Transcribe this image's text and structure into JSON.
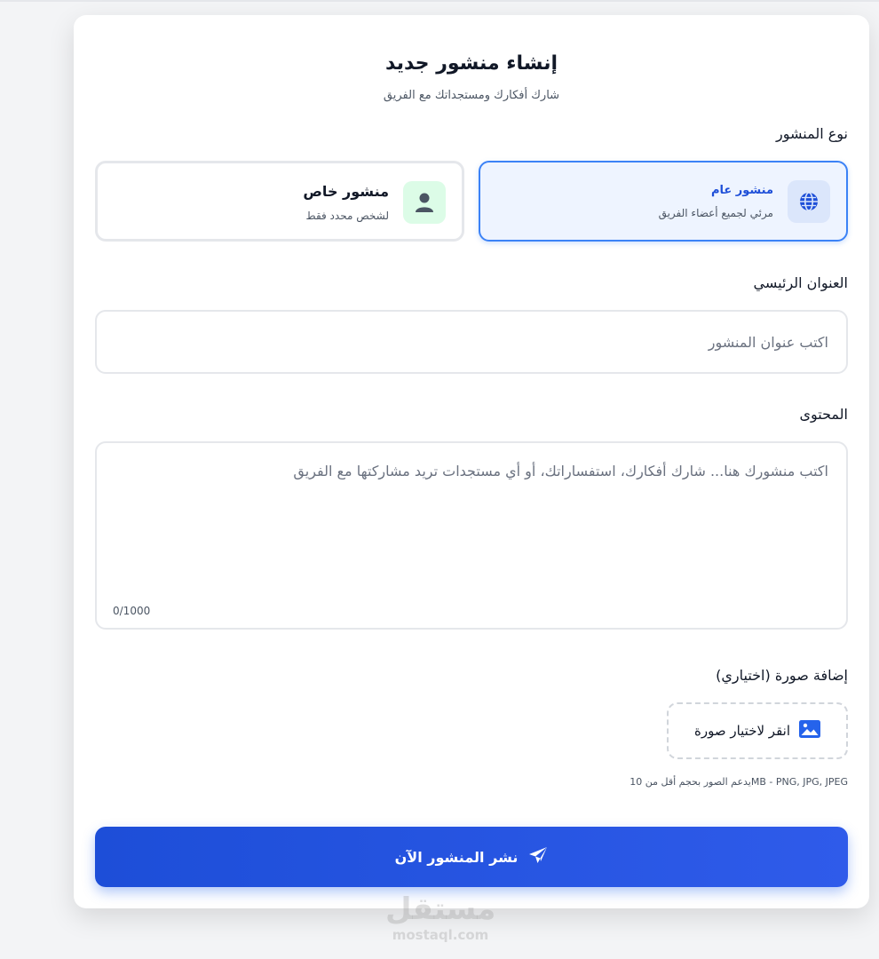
{
  "header": {
    "title": "إنشاء منشور جديد",
    "subtitle": "شارك أفكارك ومستجداتك مع الفريق"
  },
  "post_type": {
    "label": "نوع المنشور",
    "public": {
      "title": "منشور عام",
      "description": "مرئي لجميع أعضاء الفريق",
      "icon": "globe-icon",
      "selected": true
    },
    "private": {
      "title": "منشور خاص",
      "description": "لشخص محدد فقط",
      "icon": "user-icon",
      "selected": false
    }
  },
  "main_title": {
    "label": "العنوان الرئيسي",
    "placeholder": "اكتب عنوان المنشور",
    "value": ""
  },
  "content": {
    "label": "المحتوى",
    "placeholder": "اكتب منشورك هنا... شارك أفكارك، استفساراتك، أو أي مستجدات تريد مشاركتها مع الفريق",
    "value": "",
    "counter": "0/1000"
  },
  "image": {
    "label": "إضافة صورة (اختياري)",
    "button_label": "انقر لاختيار صورة",
    "icon": "image-icon",
    "hint": "يدعم الصور بحجم أقل من 10MB - PNG, JPG, JPEG"
  },
  "submit": {
    "label": "نشر المنشور الآن",
    "icon": "paper-plane-icon"
  },
  "watermark": {
    "arabic": "مستقل",
    "latin": "mostaql.com"
  },
  "colors": {
    "accent": "#2563eb",
    "accent_dark": "#1d4ed8",
    "selected_bg": "#eef4ff",
    "private_icon_bg": "#dcfce7"
  }
}
